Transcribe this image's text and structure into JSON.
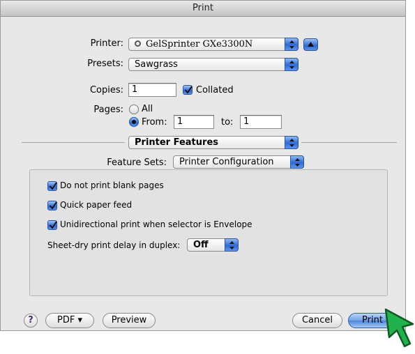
{
  "window": {
    "title": "Print"
  },
  "printer": {
    "label": "Printer:",
    "value": "GelSprinter GXe3300N"
  },
  "presets": {
    "label": "Presets:",
    "value": "Sawgrass"
  },
  "copies": {
    "label": "Copies:",
    "value": "1",
    "collated_label": "Collated",
    "collated_checked": true
  },
  "pages": {
    "label": "Pages:",
    "all_label": "All",
    "from_label": "From:",
    "from_value": "1",
    "to_label": "to:",
    "to_value": "1",
    "selected": "from"
  },
  "section_popup": {
    "value": "Printer Features"
  },
  "feature_sets": {
    "label": "Feature Sets:",
    "value": "Printer Configuration"
  },
  "options": [
    {
      "label": "Do not print blank pages",
      "checked": true
    },
    {
      "label": "Quick paper feed",
      "checked": true
    },
    {
      "label": "Unidirectional print when selector is Envelope",
      "checked": true
    }
  ],
  "duplex_delay": {
    "label": "Sheet-dry print delay in duplex:",
    "value": "Off"
  },
  "footer": {
    "help_label": "?",
    "pdf_label": "PDF ▾",
    "preview_label": "Preview",
    "cancel_label": "Cancel",
    "print_label": "Print"
  },
  "colors": {
    "accent": "#2d69d4",
    "cursor": "#22b24c"
  }
}
